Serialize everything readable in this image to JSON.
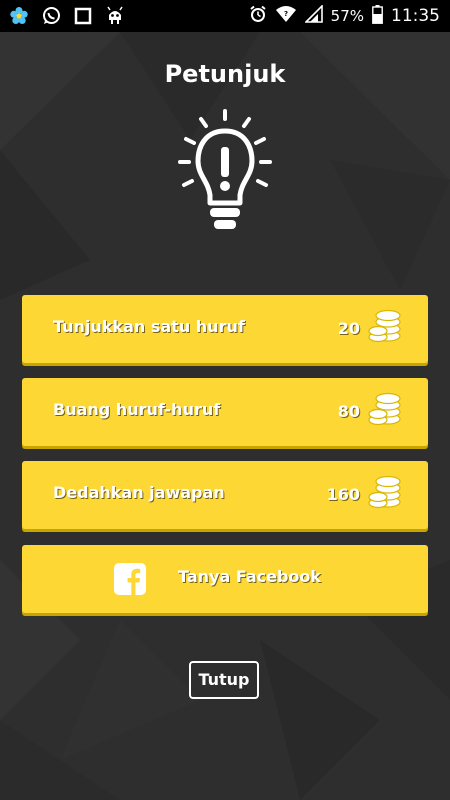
{
  "status_bar": {
    "icons_left": [
      "flower-app-icon",
      "whatsapp-icon",
      "square-app-icon",
      "android-bug-icon"
    ],
    "icons_right": [
      "alarm-icon",
      "wifi-icon",
      "signal-icon",
      "battery-icon"
    ],
    "battery_percent": "57%",
    "time": "11:35"
  },
  "dialog": {
    "title": "Petunjuk",
    "icon": "lightbulb-exclamation-icon",
    "options": [
      {
        "label": "Tunjukkan satu huruf",
        "cost": "20",
        "icon": "coins-icon"
      },
      {
        "label": "Buang huruf-huruf",
        "cost": "80",
        "icon": "coins-icon"
      },
      {
        "label": "Dedahkan jawapan",
        "cost": "160",
        "icon": "coins-icon"
      }
    ],
    "facebook": {
      "label": "Tanya Facebook",
      "icon": "facebook-icon"
    },
    "close_label": "Tutup"
  },
  "colors": {
    "background": "#2e2e2e",
    "button": "#fdd835",
    "button_shadow": "#c8a400",
    "text": "#ffffff"
  }
}
